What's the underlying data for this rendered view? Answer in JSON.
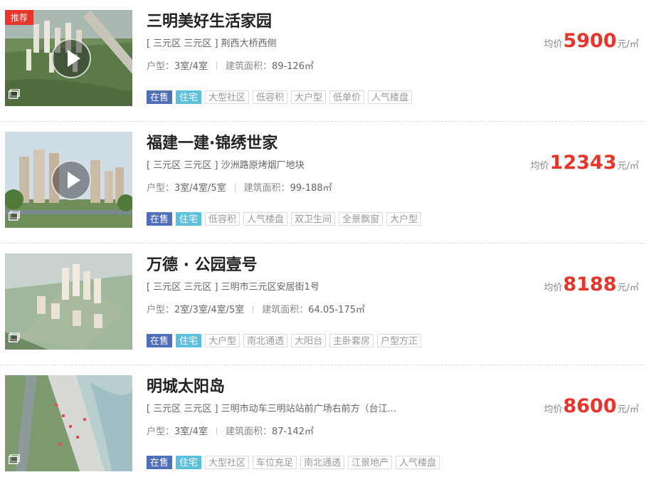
{
  "listings": [
    {
      "badge": "推荐",
      "has_play": true,
      "title": "三明美好生活家园",
      "address": "[ 三元区 三元区 ] 荆西大桥西侧",
      "layout_label": "户型：",
      "layout_value": "3室/4室",
      "area_label": "建筑面积：",
      "area_value": "89-126㎡",
      "price_prefix": "均价",
      "price_value": "5900",
      "price_unit": "元/㎡",
      "tags": [
        "在售",
        "住宅",
        "大型社区",
        "低容积",
        "大户型",
        "低单价",
        "人气楼盘"
      ]
    },
    {
      "badge": "",
      "has_play": true,
      "title": "福建一建·锦绣世家",
      "address": "[ 三元区 三元区 ] 沙洲路原烤烟厂地块",
      "layout_label": "户型：",
      "layout_value": "3室/4室/5室",
      "area_label": "建筑面积：",
      "area_value": "99-188㎡",
      "price_prefix": "均价",
      "price_value": "12343",
      "price_unit": "元/㎡",
      "tags": [
        "在售",
        "住宅",
        "低容积",
        "人气楼盘",
        "双卫生间",
        "全景飘窗",
        "大户型"
      ]
    },
    {
      "badge": "",
      "has_play": false,
      "title": "万德 · 公园壹号",
      "address": "[ 三元区 三元区 ] 三明市三元区安居街1号",
      "layout_label": "户型：",
      "layout_value": "2室/3室/4室/5室",
      "area_label": "建筑面积：",
      "area_value": "64.05-175㎡",
      "price_prefix": "均价",
      "price_value": "8188",
      "price_unit": "元/㎡",
      "tags": [
        "在售",
        "住宅",
        "大户型",
        "南北通透",
        "大阳台",
        "主卧套房",
        "户型方正"
      ]
    },
    {
      "badge": "",
      "has_play": false,
      "title": "明城太阳岛",
      "address": "[ 三元区 三元区 ] 三明市动车三明站站前广场右前方（台江...",
      "layout_label": "户型：",
      "layout_value": "3室/4室",
      "area_label": "建筑面积：",
      "area_value": "87-142㎡",
      "price_prefix": "均价",
      "price_value": "8600",
      "price_unit": "元/㎡",
      "tags": [
        "在售",
        "住宅",
        "大型社区",
        "车位充足",
        "南北通透",
        "江景地产",
        "人气楼盘"
      ]
    }
  ]
}
